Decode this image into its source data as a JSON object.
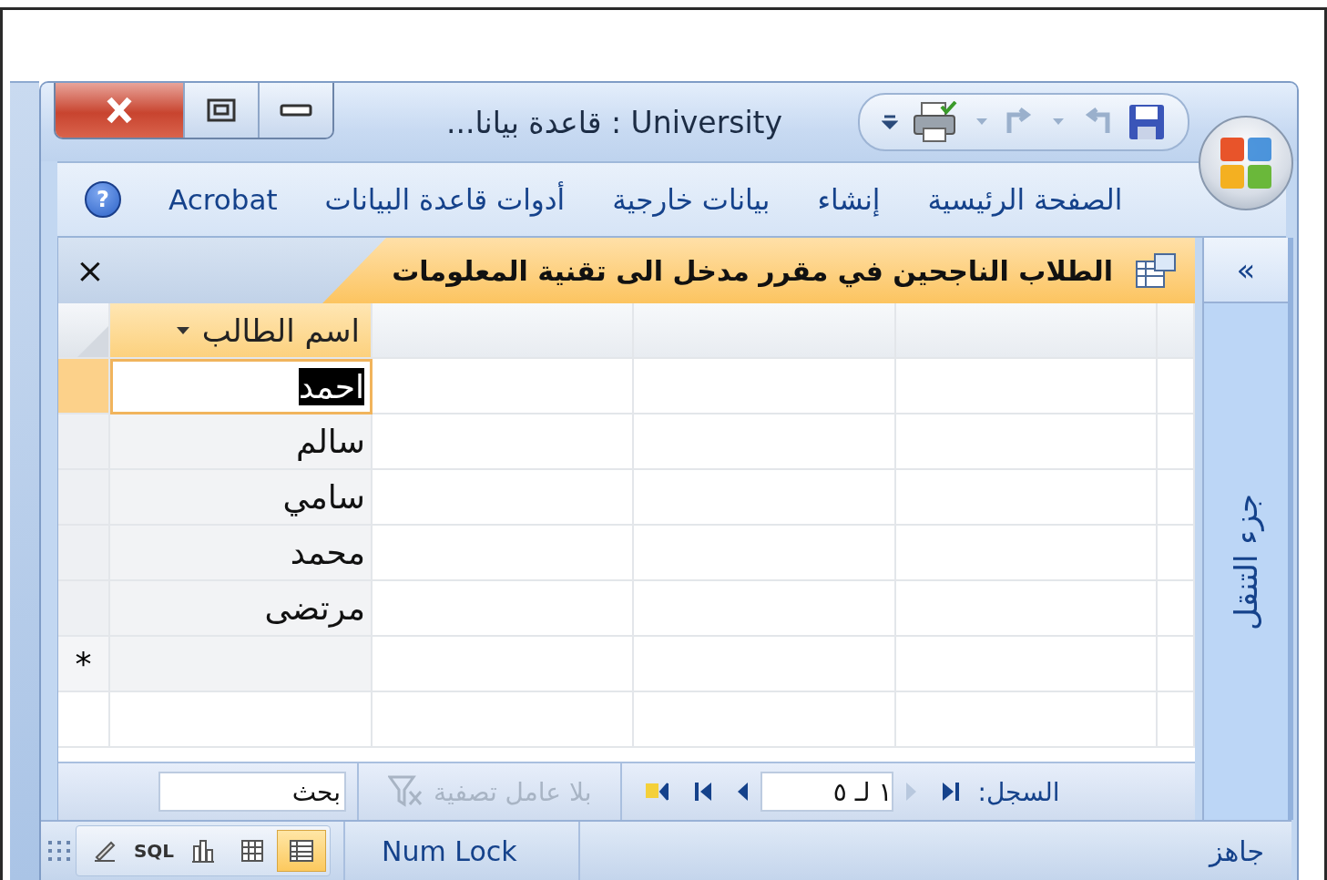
{
  "window": {
    "title": "University : قاعدة بيانا..."
  },
  "help": "?",
  "ribbon_tabs": [
    {
      "label": "الصفحة الرئيسية"
    },
    {
      "label": "إنشاء"
    },
    {
      "label": "بيانات خارجية"
    },
    {
      "label": "أدوات قاعدة البيانات"
    },
    {
      "label": "Acrobat"
    }
  ],
  "nav_pane": {
    "toggle": "«",
    "label": "جزء التنقل"
  },
  "document_tab": {
    "title": "الطلاب الناجحين في مقرر مدخل الى تقنية المعلومات",
    "close": "×"
  },
  "datasheet": {
    "columns": [
      {
        "label": "اسم الطالب"
      }
    ],
    "rows": [
      {
        "cells": [
          "احمد"
        ],
        "selected": true
      },
      {
        "cells": [
          "سالم"
        ],
        "selected": false
      },
      {
        "cells": [
          "سامي"
        ],
        "selected": false
      },
      {
        "cells": [
          "محمد"
        ],
        "selected": false
      },
      {
        "cells": [
          "مرتضى"
        ],
        "selected": false
      }
    ],
    "new_row_marker": "*"
  },
  "record_nav": {
    "label": "السجل:",
    "position": "١ لـ ٥",
    "filter": {
      "label": "بلا عامل تصفية",
      "disabled": true
    },
    "search": {
      "placeholder": "بحث"
    }
  },
  "status_bar": {
    "status": "جاهز",
    "indicator": "Num Lock",
    "views": [
      {
        "kind": "datasheet",
        "selected": true
      },
      {
        "kind": "pivot-table",
        "selected": false
      },
      {
        "kind": "pivot-chart",
        "selected": false
      },
      {
        "kind": "sql",
        "label": "SQL",
        "selected": false
      },
      {
        "kind": "design",
        "selected": false
      }
    ]
  }
}
